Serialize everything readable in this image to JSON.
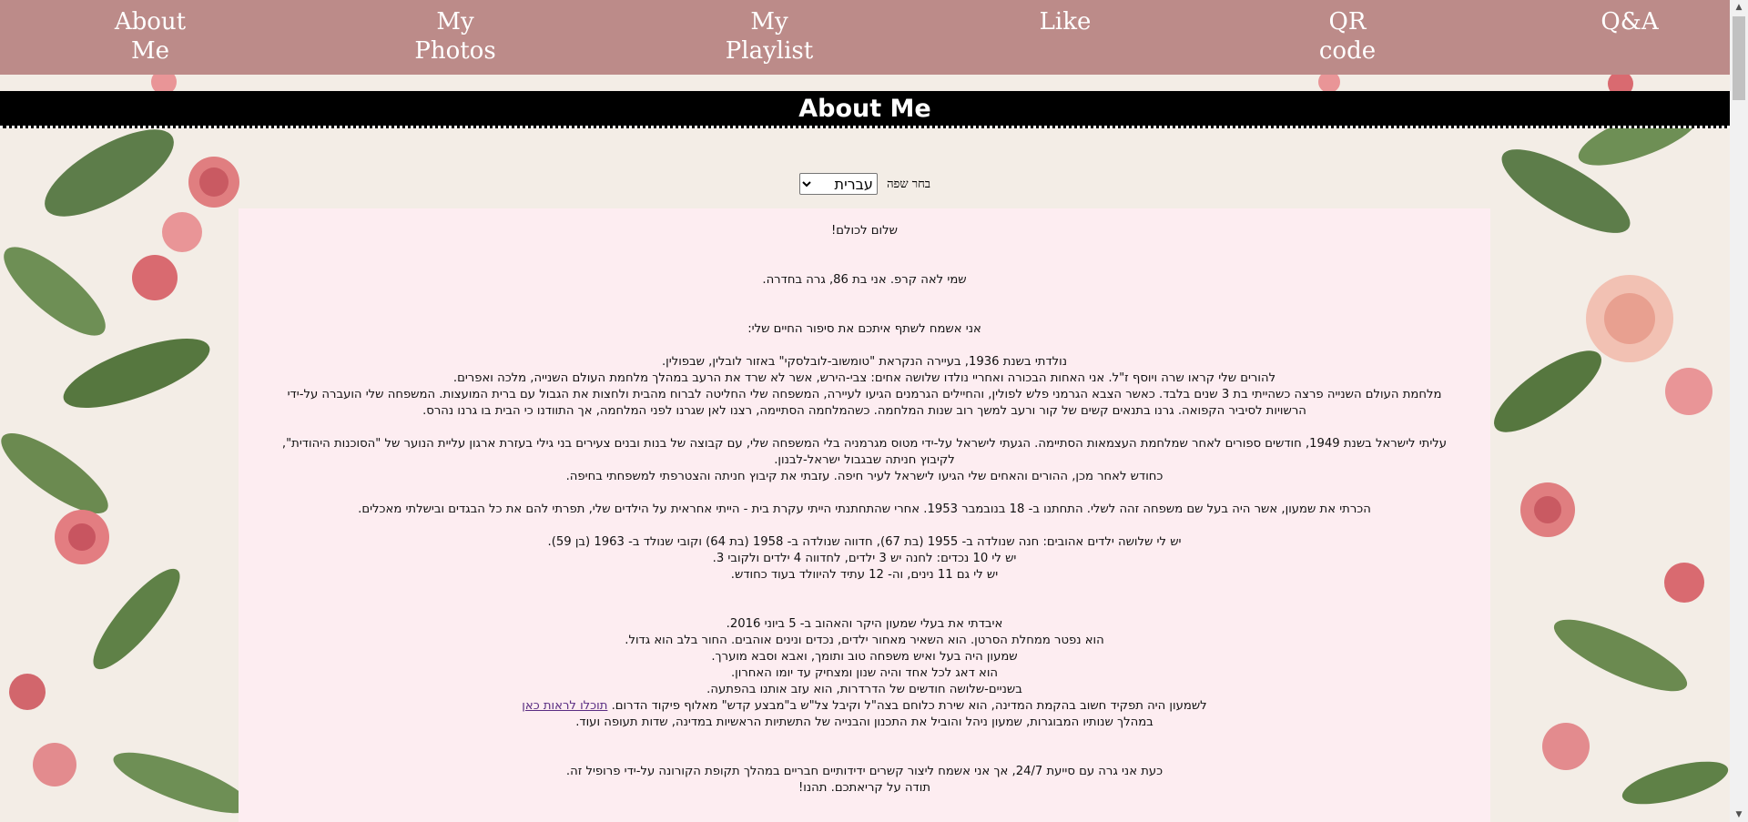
{
  "nav": {
    "items": [
      {
        "line1": "About",
        "line2": "Me"
      },
      {
        "line1": "My",
        "line2": "Photos"
      },
      {
        "line1": "My",
        "line2": "Playlist"
      },
      {
        "line1": "Like",
        "line2": ""
      },
      {
        "line1": "QR",
        "line2": "code"
      },
      {
        "line1": "Q&A",
        "line2": ""
      }
    ]
  },
  "page": {
    "title": "About Me"
  },
  "language": {
    "label": "בחר שפה",
    "selected": "עברית"
  },
  "content": {
    "greeting": "שלום לכולם!",
    "intro": "שמי לאה קרפ. אני בת 86, גרה בחדרה.",
    "share": "אני אשמח לשתף איתכם את סיפור החיים שלי:",
    "p1": [
      "נולדתי בשנת 1936, בעיירה הנקראת \"טומשוב-לובלסקי\" באזור לובלין, שבפולין.",
      "להורים שלי קראו שרה ויוסף ז\"ל. אני האחות הבכורה ואחריי נולדו שלושה אחים: צבי-הירש, אשר לא שרד את הרעב במהלך מלחמת העולם השנייה, מלכה ואפרים.",
      "מלחמת העולם השנייה פרצה כשהייתי בת 3 שנים בלבד. כאשר הצבא הגרמני פלש לפולין, והחיילים הגרמנים הגיעו לעיירה, המשפחה שלי החליטה לברוח מהבית ולחצות את הגבול עם ברית המועצות. המשפחה שלי הועברה על-ידי",
      "הרשויות לסיביר הקפואה. גרנו בתנאים קשים של קור ורעב למשך רוב שנות המלחמה. כשהמלחמה הסתיימה, רצנו לאן שגרנו לפני המלחמה, אך התוודנו כי הבית בו גרנו נהרס."
    ],
    "p2": [
      "עליתי לישראל בשנת 1949, חודשים ספורים לאחר שמלחמת העצמאות הסתיימה. הגעתי לישראל על-ידי מטוס מגרמניה בלי המשפחה שלי, עם קבוצה של בנות ובנים צעירים בני גילי בעזרת ארגון עליית הנוער של \"הסוכנות היהודית\",",
      "לקיבוץ חניתה שבגבול ישראל-לבנון.",
      "כחודש לאחר מכן, ההורים והאחים שלי הגיעו לישראל לעיר חיפה. עזבתי את קיבוץ חניתה והצטרפתי למשפחתי בחיפה."
    ],
    "p3": "הכרתי את שמעון, אשר היה בעל שם משפחה זהה לשלי. התחתנו ב- 18 בנובמבר 1953. אחרי שהתחתנתי הייתי עקרת בית - הייתי אחראית על הילדים שלי, תפרתי להם את כל הבגדים ובישלתי מאכלים.",
    "p4": [
      "יש לי שלושה ילדים אהובים: חנה שנולדה ב- 1955 (בת 67), חדווה שנולדה ב- 1958 (בת 64) וקובי שנולד ב- 1963 (בן 59).",
      "יש לי 10 נכדים: לחנה יש 3 ילדים, לחדווה 4 ילדים ולקובי 3.",
      "יש לי גם 11 נינים, וה- 12 עתיד להיוולד בעוד כחודש."
    ],
    "p5": [
      "איבדתי את בעלי שמעון היקר והאהוב ב- 5 ביוני 2016.",
      "הוא נפטר ממחלת הסרטן. הוא השאיר מאחור ילדים, נכדים ונינים אוהבים. החור בלב הוא גדול.",
      "שמעון היה בעל ואיש משפחה טוב ותומך, ואבא וסבא מוערך.",
      "הוא דאג לכל אחד והיה שנון ומצחיק עד יומו האחרון.",
      "בשניים-שלושה חודשים של הדרדרות, הוא עזב אותנו בהפתעה."
    ],
    "p5_link_line_text": "לשמעון היה תפקיד חשוב בהקמת המדינה, הוא שירת כלוחם בצה\"ל וקיבל צל\"ש ב\"מבצע קדש\" מאלוף פיקוד הדרום.",
    "p5_link": "תוכלו לראות כאן",
    "p5_last": "במהלך שנותיו המבוגרות, שמעון ניהל והוביל את התכנון והבנייה של התשתיות הראשיות במדינה, שדות תעופה ועוד.",
    "p6": [
      "כעת אני גרה עם סייעת 24/7, אך אני אשמח ליצור קשרים ידידותיים חבריים במהלך תקופת הקורונה על-ידי פרופיל זה.",
      "תודה על קריאתכם. תהנו!"
    ]
  },
  "colors": {
    "nav_bg": "#bc8b89",
    "title_bg": "#000000",
    "panel_bg": "#fdedf1",
    "link": "#5a2d82"
  }
}
